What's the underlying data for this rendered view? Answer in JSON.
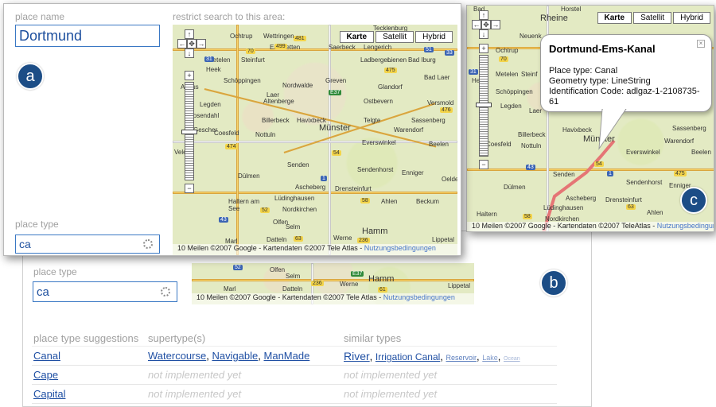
{
  "panel_b": {
    "place_type_label": "place type",
    "place_type_value": "ca",
    "map_footer": {
      "scale": "10 Meilen",
      "copyright": "©2007 Google - Kartendaten ©2007 Tele Atlas - ",
      "terms_link": "Nutzungsbedingungen"
    },
    "towns": [
      "Marl",
      "Datteln",
      "Selm",
      "Olfen",
      "Werne",
      "Hamm",
      "Lippetal"
    ],
    "road_numbers": [
      "52",
      "236",
      "E37",
      "61"
    ],
    "suggestions_headers": [
      "place type suggestions",
      "supertype(s)",
      "similar types"
    ],
    "suggestions": [
      {
        "name": "Canal",
        "supertypes": [
          "Watercourse",
          "Navigable",
          "ManMade"
        ],
        "similar": [
          "River",
          "Irrigation Canal",
          "Reservoir",
          "Lake",
          "Ocean"
        ]
      },
      {
        "name": "Cape",
        "supertypes_text": "not implemented yet",
        "similar_text": "not implemented yet"
      },
      {
        "name": "Capital",
        "supertypes_text": "not implemented yet",
        "similar_text": "not implemented yet"
      }
    ],
    "badge": "b"
  },
  "panel_a": {
    "place_name_label": "place name",
    "place_name_value": "Dortmund",
    "restrict_label": "restrict search to this area:",
    "place_type_label": "place type",
    "place_type_value": "ca",
    "badge": "a",
    "map_types": [
      "Karte",
      "Satellit",
      "Hybrid"
    ],
    "active_map_type": "Karte",
    "towns": [
      "Ochtrup",
      "Wettringen",
      "Tecklenburg",
      "Emsdetten",
      "Saerbeck",
      "Lengerich",
      "Metelen",
      "Steinfurt",
      "Ladbergen",
      "Lienen",
      "Bad Iburg",
      "Heek",
      "Greven",
      "Ahaus",
      "Schöppingen",
      "Nordwalde",
      "Glandorf",
      "Bad Laer",
      "Legden",
      "Laer",
      "Altenberge",
      "Ostbevern",
      "Versmold",
      "Rosendahl",
      "Billerbeck",
      "Havixbeck",
      "Telgte",
      "Sassenberg",
      "Gescher",
      "Münster",
      "Warendorf",
      "Coesfeld",
      "Nottuln",
      "Everswinkel",
      "Beelen",
      "Velen",
      "Senden",
      "Sendenhorst",
      "Enniger",
      "Dülmen",
      "Ascheberg",
      "Drensteinfurt",
      "Haltern am See",
      "Lüdinghausen",
      "Ahlen",
      "Beckum",
      "Nordkirchen",
      "Olfen",
      "Selm",
      "Hamm",
      "Marl",
      "Datteln",
      "Werne",
      "Lippetal",
      "Oelde"
    ],
    "road_numbers": [
      "481",
      "499",
      "51",
      "33",
      "31",
      "70",
      "475",
      "E37",
      "476",
      "54",
      "474",
      "1",
      "43",
      "52",
      "58",
      "63",
      "236",
      "61"
    ],
    "map_footer": {
      "scale": "10 Meilen",
      "copyright": "©2007 Google - Kartendaten ©2007 Tele Atlas - ",
      "terms_link": "Nutzungsbedingungen"
    }
  },
  "panel_c": {
    "badge": "c",
    "map_types": [
      "Karte",
      "Satellit",
      "Hybrid"
    ],
    "active_map_type": "Karte",
    "popup": {
      "title": "Dortmund-Ems-Kanal",
      "place_type": "Place type: Canal",
      "geometry_type": "Geometry type: LineString",
      "id_code": "Identification Code: adlgaz-1-2108735-61"
    },
    "towns": [
      "Bad",
      "Horstel",
      "Rheine",
      "Neuenk",
      "Ochtrup",
      "Heek",
      "Metelen",
      "Steinf",
      "Schöppingen",
      "Legden",
      "Laer",
      "Billerbeck",
      "Havixbeck",
      "Münster",
      "Sassenberg",
      "Warendorf",
      "Beelen",
      "Coesfeld",
      "Nottuln",
      "Everswinkel",
      "Senden",
      "Sendenhorst",
      "Enniger",
      "Dülmen",
      "Ascheberg",
      "Drensteinfurt",
      "Lüdinghausen",
      "Nordkirchen",
      "Haltern",
      "Ahlen"
    ],
    "road_numbers": [
      "70",
      "31",
      "54",
      "43",
      "1",
      "475",
      "58",
      "63"
    ],
    "map_footer": {
      "scale": "10 Meilen",
      "copyright": "©2007 Google - Kartendaten ©2007 TeleAtlas - ",
      "terms_link": "Nutzungsbedingungen"
    }
  },
  "colors": {
    "badge": "#1c4d86",
    "link": "#1f4fa3",
    "input_border": "#3a78c4",
    "canal_line": "#e57575"
  }
}
